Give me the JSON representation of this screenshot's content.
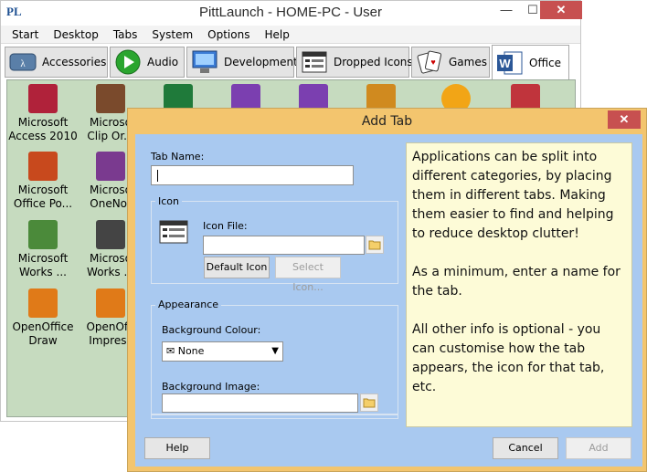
{
  "main_window": {
    "title": "PittLaunch - HOME-PC - User",
    "logo_text": "PL",
    "controls": {
      "minimize": "—",
      "maximize": "☐",
      "close": "✕"
    }
  },
  "menu": [
    "Start",
    "Desktop",
    "Tabs",
    "System",
    "Options",
    "Help"
  ],
  "tabs": [
    {
      "label": "Accessories",
      "icon": "accessories-icon"
    },
    {
      "label": "Audio",
      "icon": "play-icon"
    },
    {
      "label": "Development",
      "icon": "development-icon"
    },
    {
      "label": "Dropped Icons",
      "icon": "dropped-icons-icon"
    },
    {
      "label": "Games",
      "icon": "games-icon"
    },
    {
      "label": "Office",
      "icon": "word-icon",
      "active": true
    }
  ],
  "apps": [
    {
      "label": "Microsoft\nAccess 2010",
      "icon": "access-icon",
      "color": "#b0223a"
    },
    {
      "label": "Microso\nClip Or...",
      "icon": "clip-organizer-icon",
      "color": "#7a4a2c"
    },
    {
      "label": "",
      "icon": "excel-icon",
      "color": "#1f7a3a"
    },
    {
      "label": "",
      "icon": "infopath-icon",
      "color": "#7b3fb0"
    },
    {
      "label": "",
      "icon": "infopath-icon",
      "color": "#7b3fb0"
    },
    {
      "label": "",
      "icon": "office-tool-icon",
      "color": "#d08a1f"
    },
    {
      "label": "",
      "icon": "upload-icon",
      "color": "#f2a516"
    },
    {
      "label": "",
      "icon": "picture-manager-icon",
      "color": "#c0343c"
    },
    {
      "label": "Microsoft\nOffice Po...",
      "icon": "powerpoint-icon",
      "color": "#c8491d"
    },
    {
      "label": "Microso\nOneNot",
      "icon": "onenote-icon",
      "color": "#7a3a8f"
    },
    {
      "label": "Microsoft\nWorks ...",
      "icon": "works-icon",
      "color": "#4b8a3a"
    },
    {
      "label": "Microso\nWorks ...",
      "icon": "works-2-icon",
      "color": "#444444"
    },
    {
      "label": "OpenOffice\nDraw",
      "icon": "openoffice-draw-icon",
      "color": "#e07a18"
    },
    {
      "label": "OpenOffi\nImpress",
      "icon": "openoffice-impress-icon",
      "color": "#e07a18"
    }
  ],
  "dialog": {
    "title": "Add Tab",
    "close": "✕",
    "tab_name_label": "Tab Name:",
    "tab_name_value": "",
    "icon_group_title": "Icon",
    "icon_file_label": "Icon File:",
    "icon_file_value": "",
    "default_icon_button": "Default Icon",
    "select_icon_button": "Select Icon...",
    "appearance_group_title": "Appearance",
    "bg_colour_label": "Background Colour:",
    "bg_colour_value": "None",
    "bg_image_label": "Background Image:",
    "bg_image_value": "",
    "help_text_1": "Applications can be split into different categories, by placing them in different tabs. Making them easier to find and helping to reduce desktop clutter!",
    "help_text_2": "As a minimum, enter a name for the tab.",
    "help_text_3": "All other info is optional - you can customise how the tab appears, the icon for that tab, etc.",
    "help_button": "Help",
    "cancel_button": "Cancel",
    "add_button": "Add"
  },
  "colors": {
    "content_bg": "#c6dbbf",
    "dialog_frame": "#f3c56e",
    "dialog_body": "#a9c9f0",
    "help_panel": "#fdfbd7",
    "close_red": "#c75050"
  }
}
